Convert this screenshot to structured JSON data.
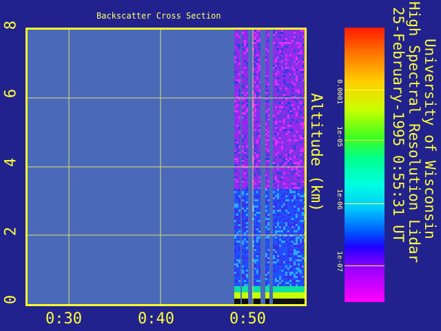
{
  "window": {
    "plot_title": "Backscatter Cross Section",
    "y_axis_label": "Altitude (km)",
    "credit_line1": "University of Wisconsin",
    "credit_line2": "High Spectral Resolution Lidar",
    "credit_line3": "25-February-1995    0:55:31 UT"
  },
  "chart_data": {
    "type": "heatmap",
    "title": "Backscatter Cross Section",
    "ylabel": "Altitude (km)",
    "ylim": [
      0,
      8
    ],
    "yticks": [
      "0",
      "2",
      "4",
      "6",
      "8"
    ],
    "xticks": [
      "0:30",
      "0:40",
      "0:50"
    ],
    "grid": true,
    "colorbar": {
      "ticks": [
        "0.0001",
        "1e-05",
        "1e-06",
        "1e-07"
      ],
      "colors": [
        "#ff1a00",
        "#ffd000",
        "#3cff20",
        "#00ffe0",
        "#0050ff",
        "#ff00ff"
      ]
    }
  },
  "colors": {
    "background": "#22228e",
    "plot_fill": "#4a6ab9",
    "axis": "#ffff28"
  }
}
